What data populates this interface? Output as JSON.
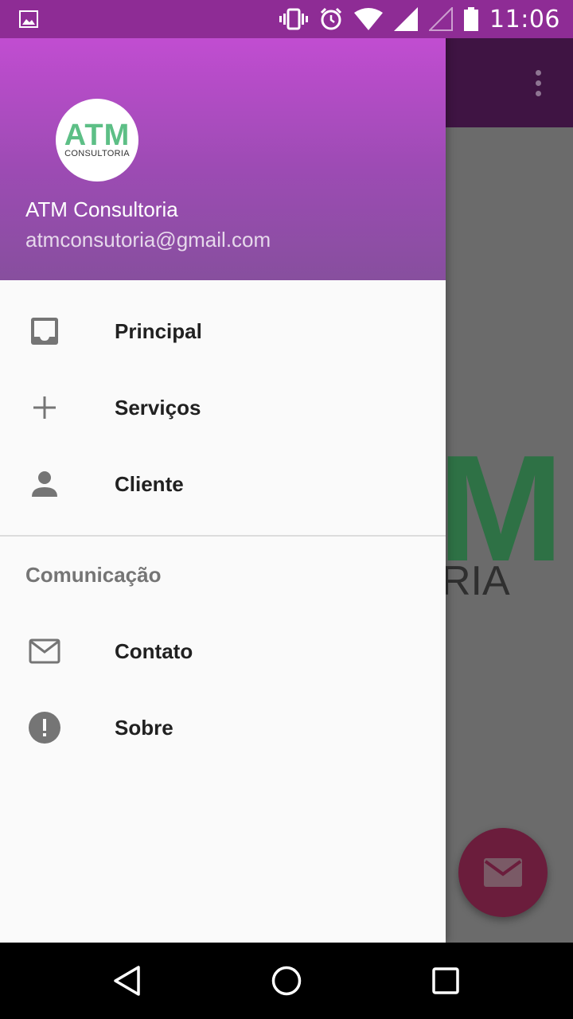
{
  "status_bar": {
    "time": "11:06",
    "icons": [
      "image-notification-icon",
      "vibrate-icon",
      "alarm-icon",
      "wifi-icon",
      "signal-full-icon",
      "signal-empty-icon",
      "battery-icon"
    ]
  },
  "drawer": {
    "header": {
      "logo_main": "ATM",
      "logo_sub": "CONSULTORIA",
      "name": "ATM Consultoria",
      "email": "atmconsutoria@gmail.com"
    },
    "items": [
      {
        "label": "Principal",
        "icon": "inbox-icon"
      },
      {
        "label": "Serviços",
        "icon": "plus-icon"
      },
      {
        "label": "Cliente",
        "icon": "person-icon"
      }
    ],
    "section_title": "Comunicação",
    "section_items": [
      {
        "label": "Contato",
        "icon": "mail-icon"
      },
      {
        "label": "Sobre",
        "icon": "info-exclamation-icon"
      }
    ]
  },
  "background": {
    "logo_letter": "M",
    "logo_fragment": "RIA",
    "fab_icon": "mail-icon"
  },
  "nav_bar": {
    "buttons": [
      "back-icon",
      "home-icon",
      "recents-icon"
    ]
  },
  "colors": {
    "header_gradient_top": "#c14dd1",
    "header_gradient_bottom": "#874f9e",
    "status_bar": "#8e2c95",
    "logo_green": "#5dbf86",
    "fab": "#6b1d3c"
  }
}
